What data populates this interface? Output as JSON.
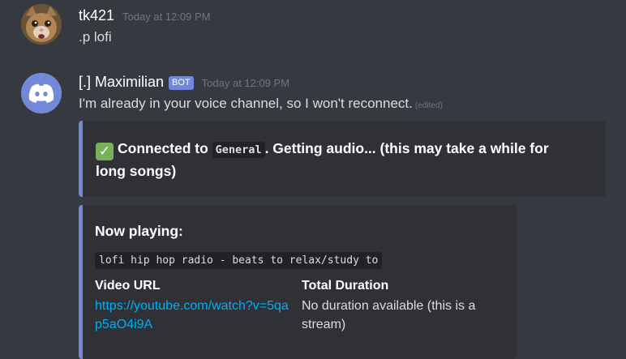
{
  "messages": [
    {
      "username": "tk421",
      "timestamp": "Today at 12:09 PM",
      "content": ".p lofi"
    },
    {
      "username": "[.] Maximilian",
      "badge": "BOT",
      "timestamp": "Today at 12:09 PM",
      "content": "I'm already in your voice channel, so I won't reconnect.",
      "edited": "(edited)"
    }
  ],
  "embed1": {
    "emoji": "✓",
    "text_before": "Connected to ",
    "channel": "General",
    "text_after": ". Getting audio... (this may take a while for long songs)"
  },
  "embed2": {
    "title": "Now playing:",
    "code": "lofi hip hop radio - beats to relax/study to",
    "fields": [
      {
        "name": "Video URL",
        "value": "https://youtube.com/watch?v=5qap5aO4i9A"
      },
      {
        "name": "Total Duration",
        "value": "No duration available (this is a stream)"
      }
    ]
  },
  "colors": {
    "background": "#36393f",
    "embed_bg": "#2f3136",
    "embed_accent": "#7289da",
    "bot_badge": "#7289da",
    "link": "#00b0f4",
    "discord_avatar": "#7289da"
  },
  "icons": {
    "user_avatar": "cat-avatar-icon",
    "bot_avatar": "discord-logo-icon",
    "emoji": "check-mark-emoji-icon"
  }
}
